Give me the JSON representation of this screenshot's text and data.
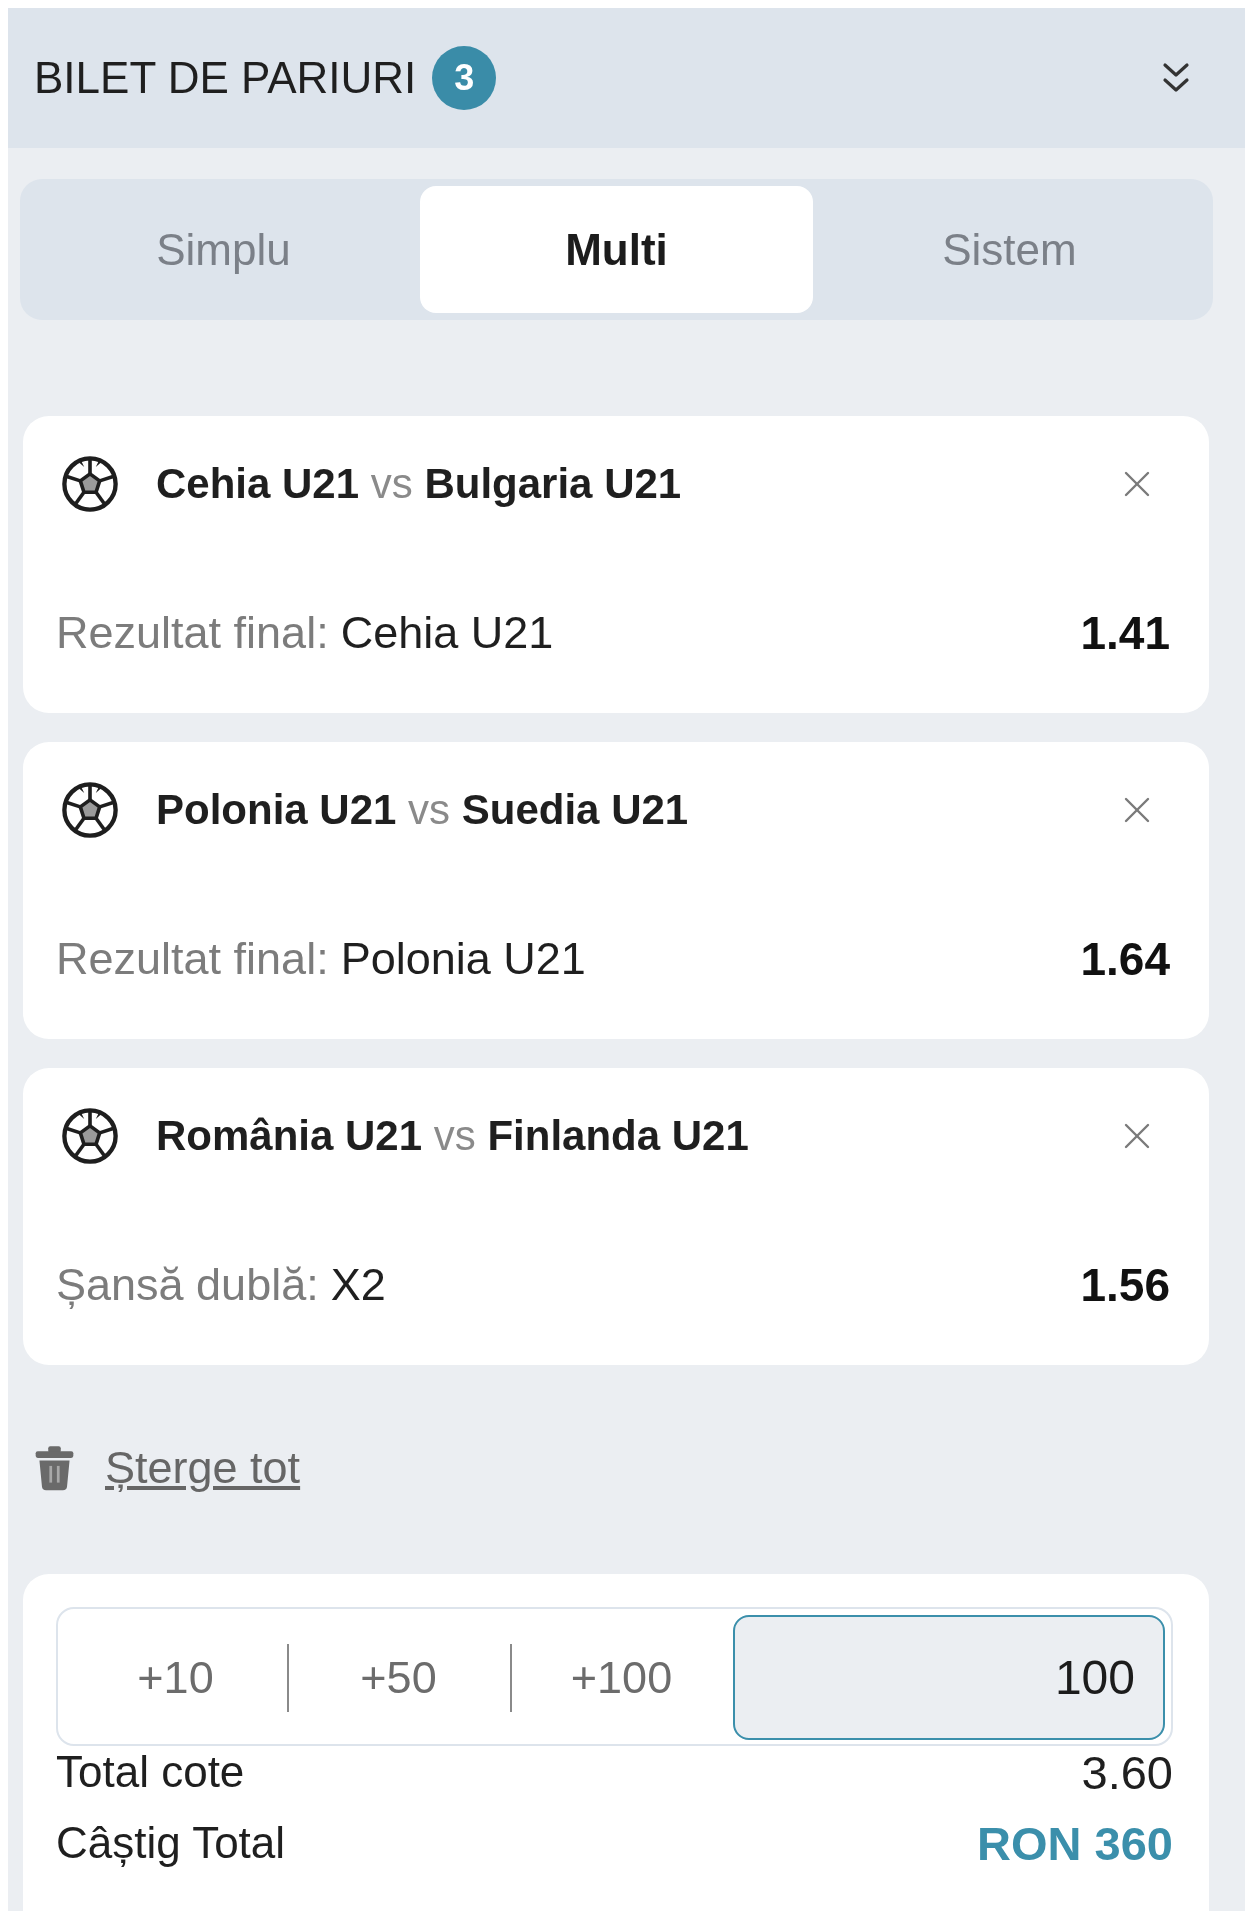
{
  "header": {
    "title": "BILET DE PARIURI",
    "count": "3"
  },
  "tabs": [
    {
      "label": "Simplu",
      "selected": false
    },
    {
      "label": "Multi",
      "selected": true
    },
    {
      "label": "Sistem",
      "selected": false
    }
  ],
  "bets": [
    {
      "home": "Cehia U21",
      "separator": "vs",
      "away": "Bulgaria U21",
      "market": "Rezultat final:",
      "pick": "Cehia U21",
      "odds": "1.41"
    },
    {
      "home": "Polonia U21",
      "separator": "vs",
      "away": "Suedia U21",
      "market": "Rezultat final:",
      "pick": "Polonia U21",
      "odds": "1.64"
    },
    {
      "home": "România U21",
      "separator": "vs",
      "away": "Finlanda U21",
      "market": "Șansă dublă:",
      "pick": "X2",
      "odds": "1.56"
    }
  ],
  "clear_all": "Șterge tot",
  "stake": {
    "quick_amounts": [
      "+10",
      "+50",
      "+100"
    ],
    "value": "100"
  },
  "summary": [
    {
      "label": "Total cote",
      "value": "3.60",
      "kind": "plain"
    },
    {
      "label": "Câștig Total",
      "value": "RON 360",
      "kind": "highlight"
    }
  ]
}
